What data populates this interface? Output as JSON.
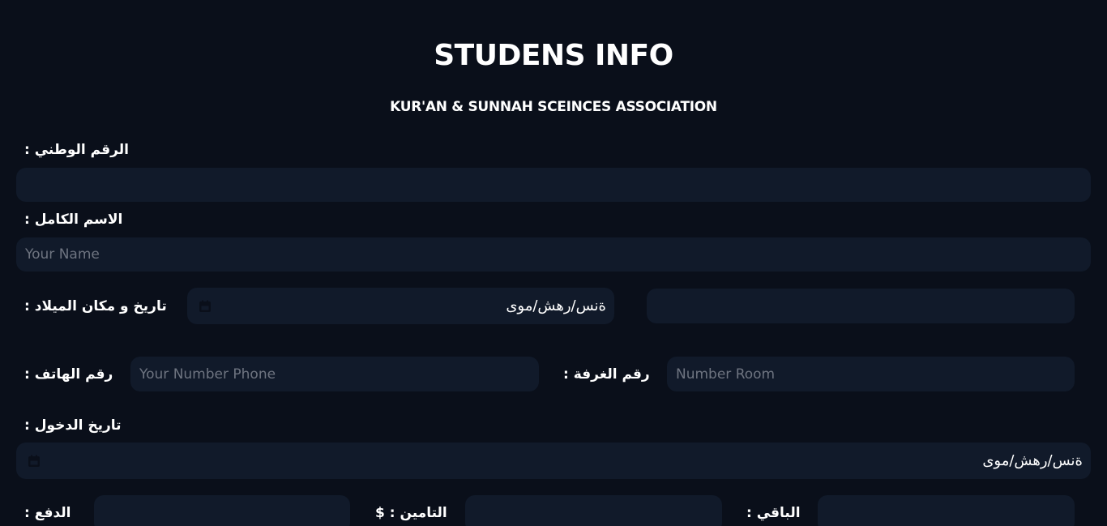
{
  "header": {
    "title": "STUDENS INFO",
    "subtitle": "KUR'AN & SUNNAH SCEINCES ASSOCIATION"
  },
  "form": {
    "national_id": {
      "label": "الرقم الوطني :",
      "value": "",
      "placeholder": ""
    },
    "full_name": {
      "label": "الاسم الكامل :",
      "value": "",
      "placeholder": "Your Name"
    },
    "birth": {
      "label": "تاريخ و مكان الميلاد :",
      "date_display": "ةنس/رهش/موى",
      "place_value": "",
      "place_placeholder": ""
    },
    "phone": {
      "label": "رقم الهاتف :",
      "value": "",
      "placeholder": "Your Number Phone"
    },
    "room": {
      "label": "رقم الغرفة :",
      "value": "",
      "placeholder": "Number Room"
    },
    "entry_date": {
      "label": "تاريخ الدخول :",
      "date_display": "ةنس/رهش/موى"
    },
    "payment": {
      "label": "الدفع :",
      "value": ""
    },
    "insurance": {
      "label": "التامين : $",
      "value": ""
    },
    "remaining": {
      "label": "الباقي :",
      "value": ""
    }
  },
  "icons": {
    "date_picker": "calendar-icon"
  },
  "colors": {
    "background": "#0a0f1a",
    "field": "#111a2a",
    "placeholder": "#6e7480",
    "text": "#ffffff"
  }
}
